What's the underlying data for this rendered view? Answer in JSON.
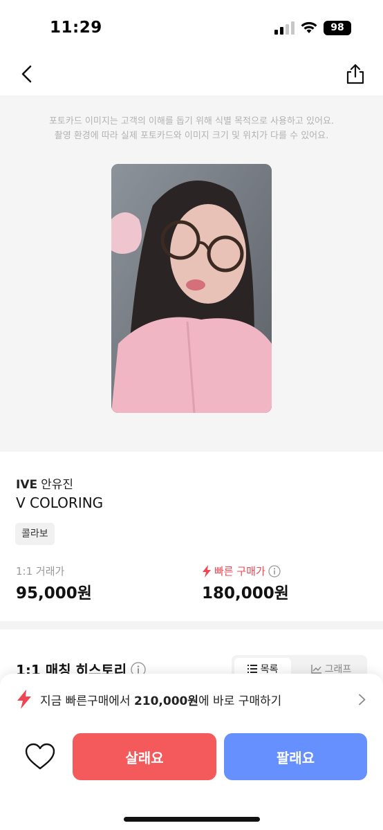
{
  "status_bar": {
    "time": "11:29",
    "battery": "98"
  },
  "image_section": {
    "disclaimer_line1": "포토카드 이미지는 고객의 이해를 돕기 위해 식별 목적으로 사용하고 있어요.",
    "disclaimer_line2": "촬영 환경에 따라 실제 포토카드와 이미지 크기 및 위치가 다를 수 있어요."
  },
  "product": {
    "group": "IVE",
    "member": "안유진",
    "album": "V COLORING",
    "tag": "콜라보"
  },
  "prices": {
    "trade_label": "1:1 거래가",
    "trade_value": "95,000원",
    "quick_label": "빠른 구매가",
    "quick_value": "180,000원"
  },
  "history": {
    "title": "1:1 매칭 히스토리",
    "toggle_list": "목록",
    "toggle_graph": "그래프"
  },
  "bottom": {
    "quick_buy_prefix": "지금 빠른구매에서 ",
    "quick_buy_price": "210,000원",
    "quick_buy_suffix": "에 바로 구매하기",
    "buy_label": "살래요",
    "sell_label": "팔래요"
  },
  "colors": {
    "buy": "#f45a5c",
    "sell": "#6690fd",
    "accent_red": "#f04452"
  },
  "icons": [
    "back-arrow-icon",
    "share-icon",
    "bolt-icon",
    "info-icon",
    "list-icon",
    "graph-icon",
    "chevron-right-icon",
    "heart-icon"
  ]
}
